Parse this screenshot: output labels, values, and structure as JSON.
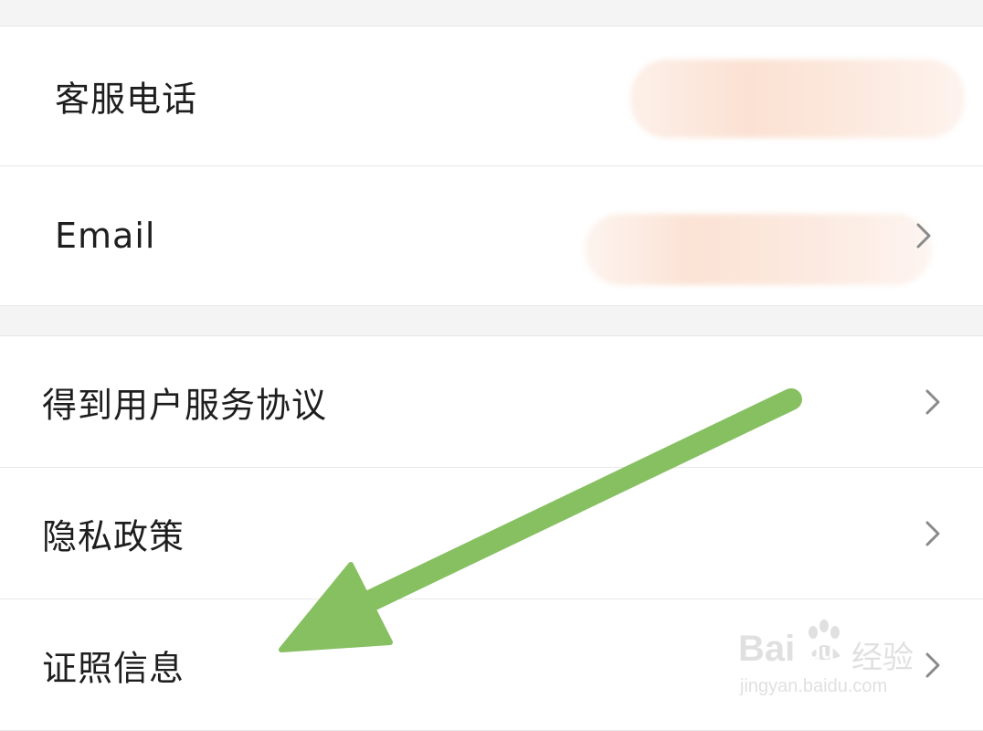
{
  "rows": [
    {
      "label": "客服电话"
    },
    {
      "label": "Email"
    },
    {
      "label": "得到用户服务协议"
    },
    {
      "label": "隐私政策"
    },
    {
      "label": "证照信息"
    }
  ],
  "watermark": {
    "brand": "Bai",
    "paw_text": "du",
    "suffix": "经验",
    "url": "jingyan.baidu.com"
  },
  "colors": {
    "arrow": "#86c061",
    "chevron": "#8a8a8a",
    "redaction": "#fbe3d6"
  }
}
